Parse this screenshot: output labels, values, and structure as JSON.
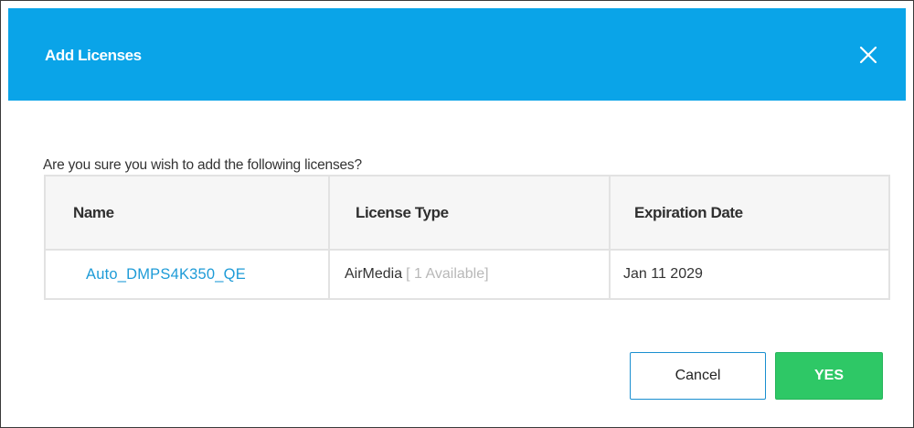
{
  "dialog": {
    "title": "Add Licenses",
    "close_icon": "close-icon",
    "prompt": "Are you sure you wish to add the following licenses?"
  },
  "table": {
    "headers": [
      "Name",
      "License Type",
      "Expiration Date"
    ],
    "rows": [
      {
        "name": "Auto_DMPS4K350_QE",
        "license_type": "AirMedia",
        "available": "[ 1 Available]",
        "expiration": "Jan 11 2029"
      }
    ]
  },
  "buttons": {
    "cancel": "Cancel",
    "yes": "YES"
  },
  "colors": {
    "header_bg": "#0aa4e8",
    "link": "#1e9bd7",
    "yes_bg": "#2ec866",
    "cancel_border": "#1a8fd0",
    "muted_text": "#b8b8b8"
  }
}
